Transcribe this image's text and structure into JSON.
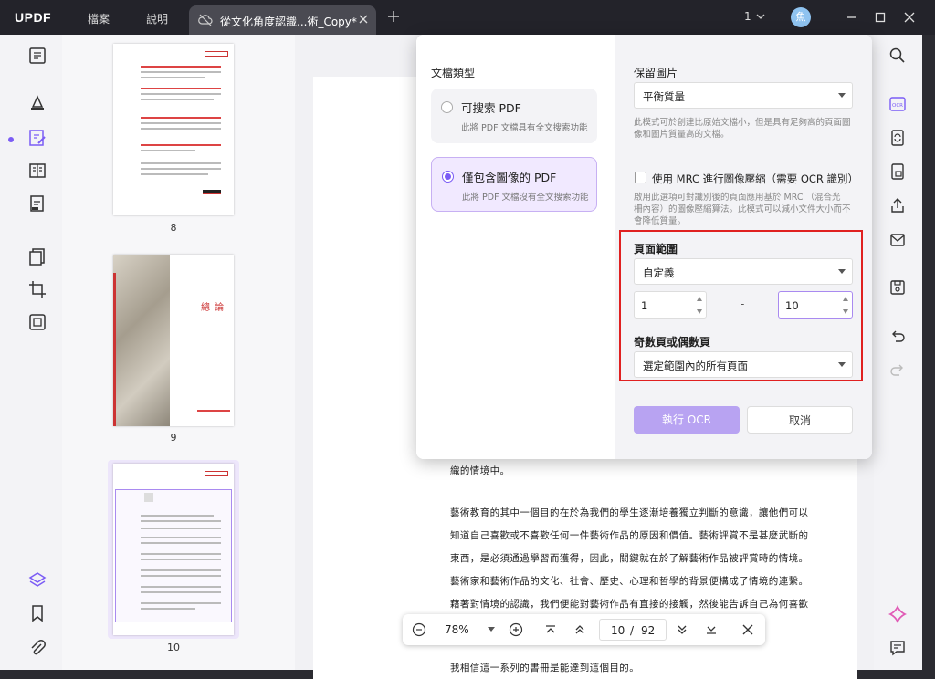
{
  "app": {
    "logo": "UPDF"
  },
  "menu": {
    "file": "檔案",
    "help": "說明"
  },
  "tab": {
    "title": "從文化角度認識...術_Copy*"
  },
  "window": {
    "page_indicator": "1",
    "avatar_letter": "魚"
  },
  "thumbnails": [
    {
      "number": "8"
    },
    {
      "number": "9",
      "title": "總 論"
    },
    {
      "number": "10"
    }
  ],
  "document": {
    "lines": [
      "織的情境中。",
      "藝術教育的其中一個目的在於為我們的學生逐漸培養獨立判斷的意識，讓他們可以",
      "知道自己喜歡或不喜歡任何一件藝術作品的原因和價值。藝術評賞不是甚麼武斷的",
      "東西，是必須通過學習而獲得，因此，關鍵就在於了解藝術作品被評賞時的情境。",
      "藝術家和藝術作品的文化、社會、歷史、心理和哲學的背景便構成了情境的連繫。",
      "藉著對情境的認識，我們便能對藝術作品有直接的接觸，然後能告訴自己為何喜歡",
      "我相信這一系列的書冊是能達到這個目的。"
    ]
  },
  "ocr_dialog": {
    "doc_type_label": "文檔類型",
    "options": [
      {
        "title": "可搜索 PDF",
        "desc": "此將 PDF 文檔具有全文搜索功能",
        "selected": false
      },
      {
        "title": "僅包含圖像的 PDF",
        "desc": "此將 PDF 文檔沒有全文搜索功能",
        "selected": true
      }
    ],
    "keep_images_label": "保留圖片",
    "keep_images_value": "平衡質量",
    "keep_images_desc_1": "此模式可於創建比原始文檔小，但是具有足夠高的頁面圖",
    "keep_images_desc_2": "像和圖片質量高的文檔。",
    "mrc_label": "使用 MRC 進行圖像壓縮（需要 OCR 識別）",
    "mrc_checked": false,
    "mrc_desc_1": "啟用此選項可對識別後的頁面應用基於 MRC （混合光",
    "mrc_desc_2": "柵內容）的圖像壓縮算法。此模式可以減小文件大小而不",
    "mrc_desc_3": "會降低質量。",
    "page_range_label": "頁面範圍",
    "page_range_value": "自定義",
    "range_from": "1",
    "range_sep": "-",
    "range_to": "10",
    "odd_even_label": "奇數頁或偶數頁",
    "odd_even_value": "選定範圍內的所有頁面",
    "run_button": "執行 OCR",
    "cancel_button": "取消"
  },
  "zoom": {
    "level": "78%",
    "current_page": "10",
    "sep": "/",
    "total_pages": "92"
  },
  "colors": {
    "accent": "#7b5cf5",
    "highlight_box": "#e02020",
    "titlebar": "#23232a"
  }
}
